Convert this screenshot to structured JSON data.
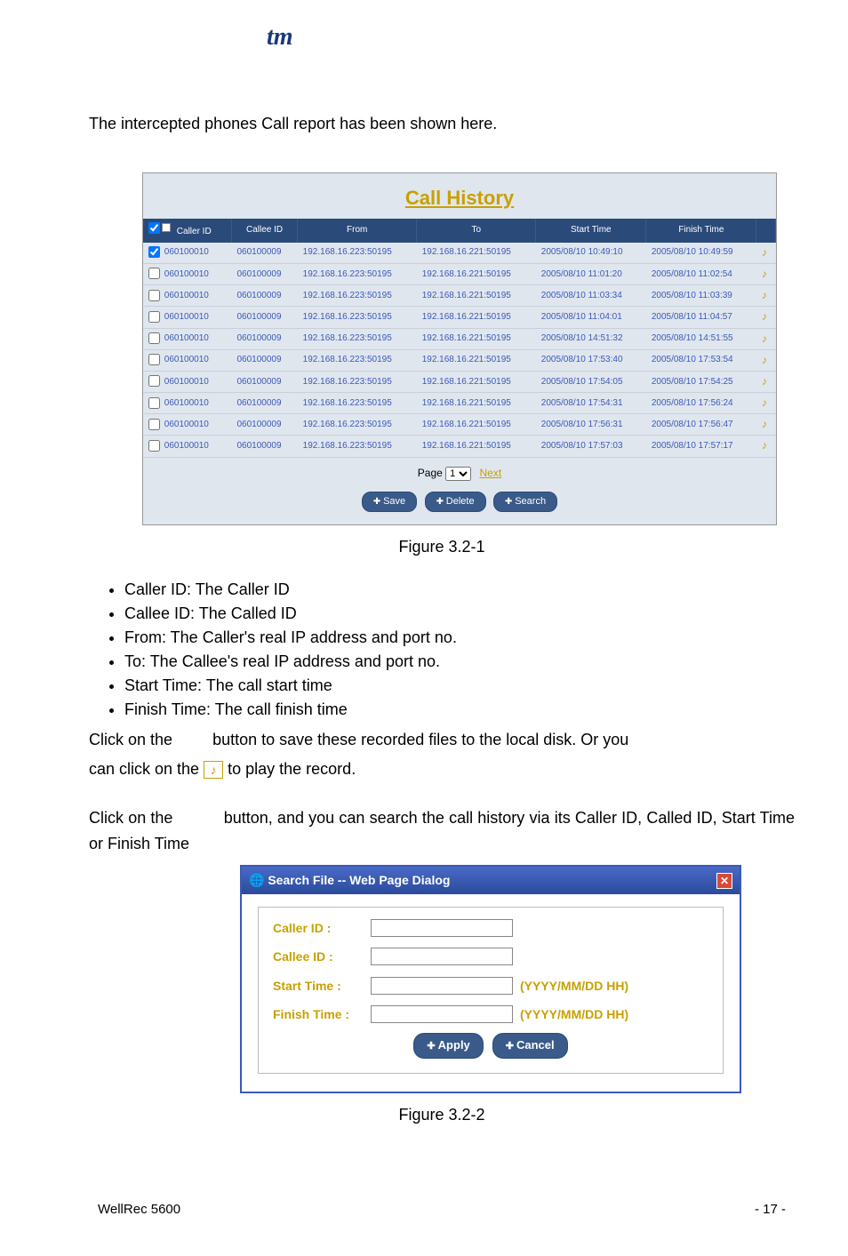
{
  "logo_text": "tm",
  "intro": "The intercepted phones Call report has been shown here.",
  "call_history": {
    "title": "Call History",
    "headers": {
      "caller_id": "Caller ID",
      "callee_id": "Callee ID",
      "from": "From",
      "to": "To",
      "start": "Start Time",
      "finish": "Finish Time"
    },
    "rows": [
      {
        "checked": true,
        "caller": "060100010",
        "callee": "060100009",
        "from": "192.168.16.223:50195",
        "to": "192.168.16.221:50195",
        "start": "2005/08/10 10:49:10",
        "finish": "2005/08/10 10:49:59"
      },
      {
        "checked": false,
        "caller": "060100010",
        "callee": "060100009",
        "from": "192.168.16.223:50195",
        "to": "192.168.16.221:50195",
        "start": "2005/08/10 11:01:20",
        "finish": "2005/08/10 11:02:54"
      },
      {
        "checked": false,
        "caller": "060100010",
        "callee": "060100009",
        "from": "192.168.16.223:50195",
        "to": "192.168.16.221:50195",
        "start": "2005/08/10 11:03:34",
        "finish": "2005/08/10 11:03:39"
      },
      {
        "checked": false,
        "caller": "060100010",
        "callee": "060100009",
        "from": "192.168.16.223:50195",
        "to": "192.168.16.221:50195",
        "start": "2005/08/10 11:04:01",
        "finish": "2005/08/10 11:04:57"
      },
      {
        "checked": false,
        "caller": "060100010",
        "callee": "060100009",
        "from": "192.168.16.223:50195",
        "to": "192.168.16.221:50195",
        "start": "2005/08/10 14:51:32",
        "finish": "2005/08/10 14:51:55"
      },
      {
        "checked": false,
        "caller": "060100010",
        "callee": "060100009",
        "from": "192.168.16.223:50195",
        "to": "192.168.16.221:50195",
        "start": "2005/08/10 17:53:40",
        "finish": "2005/08/10 17:53:54"
      },
      {
        "checked": false,
        "caller": "060100010",
        "callee": "060100009",
        "from": "192.168.16.223:50195",
        "to": "192.168.16.221:50195",
        "start": "2005/08/10 17:54:05",
        "finish": "2005/08/10 17:54:25"
      },
      {
        "checked": false,
        "caller": "060100010",
        "callee": "060100009",
        "from": "192.168.16.223:50195",
        "to": "192.168.16.221:50195",
        "start": "2005/08/10 17:54:31",
        "finish": "2005/08/10 17:56:24"
      },
      {
        "checked": false,
        "caller": "060100010",
        "callee": "060100009",
        "from": "192.168.16.223:50195",
        "to": "192.168.16.221:50195",
        "start": "2005/08/10 17:56:31",
        "finish": "2005/08/10 17:56:47"
      },
      {
        "checked": false,
        "caller": "060100010",
        "callee": "060100009",
        "from": "192.168.16.223:50195",
        "to": "192.168.16.221:50195",
        "start": "2005/08/10 17:57:03",
        "finish": "2005/08/10 17:57:17"
      }
    ],
    "pager": {
      "page_label": "Page",
      "page_value": "1",
      "next": "Next"
    },
    "buttons": {
      "save": "Save",
      "delete": "Delete",
      "search": "Search"
    }
  },
  "figure1_cap": "Figure 3.2-1",
  "bullets": [
    "Caller ID: The Caller ID",
    "Callee ID: The Called ID",
    "From: The Caller's real IP address and port no.",
    "To: The Callee's real IP address and port no.",
    "Start Time: The call start time",
    "Finish Time: The call finish time"
  ],
  "para1a": "Click on the",
  "para1b": "button to save these recorded files to the local disk. Or you",
  "para2a": "can click on the",
  "para2b": "to play the record.",
  "para3a": "Click on the",
  "para3b": "button, and you can search the call history via its Caller ID, Called ID, Start Time or Finish Time",
  "search_dialog": {
    "title": "Search File -- Web Page Dialog",
    "labels": {
      "caller": "Caller ID :",
      "callee": "Callee ID :",
      "start": "Start Time :",
      "finish": "Finish Time :"
    },
    "hint": "(YYYY/MM/DD HH)",
    "buttons": {
      "apply": "Apply",
      "cancel": "Cancel"
    }
  },
  "figure2_cap": "Figure 3.2-2",
  "footer": {
    "left": "WellRec 5600",
    "right": "- 17 -"
  }
}
